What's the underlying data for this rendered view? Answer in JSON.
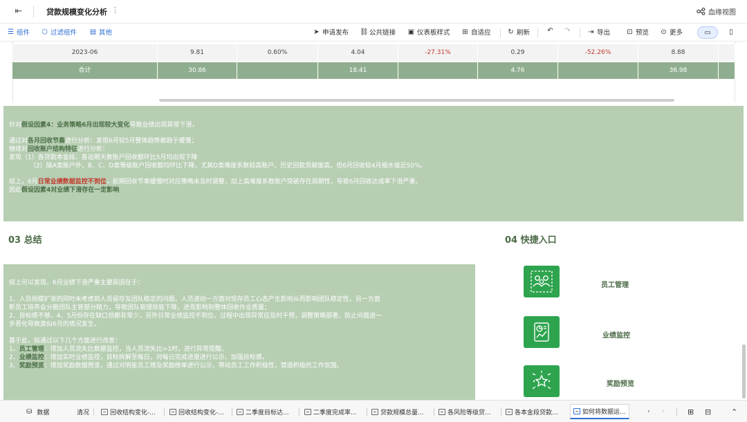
{
  "header": {
    "title": "贷款规模变化分析",
    "more_icon": "⋮",
    "lineage_label": "血缘视图"
  },
  "toolbar_left": [
    {
      "label": "组件",
      "icon": "component-icon"
    },
    {
      "label": "过滤组件",
      "icon": "filter-cube-icon"
    },
    {
      "label": "其他",
      "icon": "doc-icon"
    }
  ],
  "toolbar_right": {
    "apply": "申请发布",
    "link": "公共链接",
    "style": "仪表板样式",
    "adaptive": "自适应",
    "refresh": "刷新",
    "export": "导出",
    "preview": "预览",
    "more": "更多"
  },
  "table": {
    "data_row": [
      "2023-06",
      "9.81",
      "0.60%",
      "4.04",
      "-27.31%",
      "0.29",
      "-52.26%",
      "8.88"
    ],
    "total_row": [
      "合计",
      "30.86",
      "",
      "18.41",
      "",
      "4.76",
      "",
      "36.98"
    ]
  },
  "hint": {
    "l1a": "针对",
    "l1b": "假设因素4：业务策略6月出现较大变化",
    "l1c": "导致业绩出现异常下滑，",
    "l2a": "通过对",
    "l2b": "各月回收节奏",
    "l2c": "进行分析：发现6月较5月整体趋势都趋于缓慢；",
    "l3a": "继续对",
    "l3b": "回收账户结构特征",
    "l3c": "进行分析：",
    "l4": "发现（1）各贷款本金段、各逾期天数账户回收额环比5月均出现下降",
    "l5": "（2）除A类账户外，B、C、D类等级账户回收额均环比下降，尤其D类难度系数较高账户。历史回款贡献度高，但6月回收较4月缩水接近50%。",
    "l6a": "综上，6月",
    "l6b": "日常业绩数据监控不到位",
    "l6c": "，前期回收节奏缓慢时对应策略未及时调整，加上高难度系数账户突破存在周期性，导致6月回收达成率下滑严重。",
    "l7a": "因此",
    "l7b": "假设因素4对业绩下滑存在一定影响"
  },
  "section_summary_title": "03 总结",
  "section_quick_title": "04 快捷入口",
  "summary": {
    "s1": "综上可以发现，6月业绩下滑严重主要原因在于：",
    "s2": "1、人员规模扩张的同时未考虑到人员留存及团队稳定的问题。人员波动一方面对现存员工心态产生影响从而影响团队稳定性，另一方面",
    "s3": "新员工培养会分散团队主管部分精力，导致团队管理效能下降，进而影响到整体回收作业质量；",
    "s4": "2、目标感不够，4、5月份存在缺口但都非常少，另外日常业绩监控不到位，过程中出现异常应及时干预，调整策略部署，防止问题进一",
    "s5": "步恶化导致类似6月的情况发生。",
    "s6": "基于此，拟通过以下几个方面进行改善：",
    "s7a": "1、",
    "s7b": "员工管理",
    "s7c": "：增加人员流失比数据监控，当人员流失比>1时，进行异常提醒。",
    "s8a": "2、",
    "s8b": "业绩监控",
    "s8c": "：增加实时业绩监控，目标拆解至每日，对每日完成进度进行公示，加强目标感。",
    "s9a": "3、",
    "s9b": "奖励预览",
    "s9c": "：增加奖励数据预览，通过对明星员工榜及奖励榜单进行公示，带动员工工作积极性，营造积极的工作氛围。"
  },
  "quick_links": [
    {
      "label": "员工管理",
      "icon": "team-icon"
    },
    {
      "label": "业绩监控",
      "icon": "chart-report-icon"
    },
    {
      "label": "奖励预览",
      "icon": "star-award-icon"
    }
  ],
  "tabs": {
    "data": "数据",
    "t0": "清况",
    "t1": "回收结构变化-...",
    "t2": "回收结构变化-...",
    "t3": "二季度目标达...",
    "t4": "二季度完成率...",
    "t5": "贷款规模总量...",
    "t6": "各风险等级贷...",
    "t7": "各本金段贷款...",
    "t8": "如何将数据运..."
  },
  "colors": {
    "panel_green": "#b7ceb3",
    "total_row": "#8fae8f",
    "accent_blue": "#2f6fd6",
    "quick_green": "#2ea44f",
    "negative": "#c0392b"
  }
}
